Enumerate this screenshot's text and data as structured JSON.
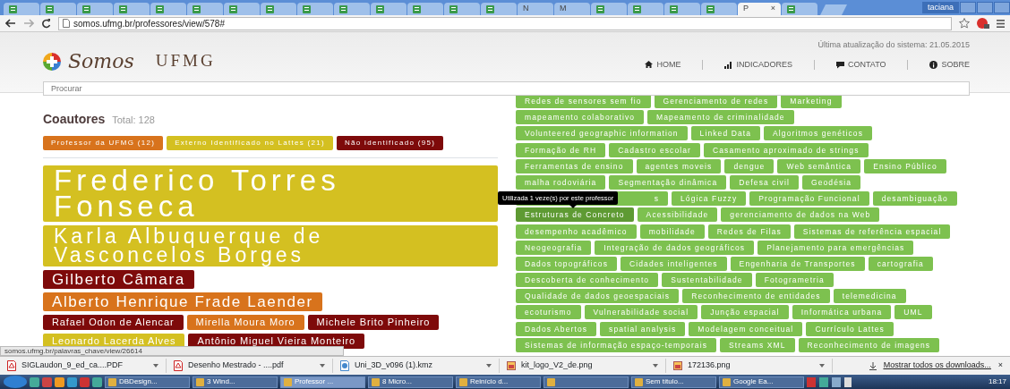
{
  "browser": {
    "tabs": [
      {
        "selected": false
      },
      {
        "selected": false
      },
      {
        "selected": false
      },
      {
        "selected": false
      },
      {
        "selected": false
      },
      {
        "selected": false
      },
      {
        "selected": false
      },
      {
        "selected": false
      },
      {
        "selected": false
      },
      {
        "selected": false
      },
      {
        "selected": false
      },
      {
        "selected": false
      },
      {
        "selected": false
      },
      {
        "selected": false
      },
      {
        "selected": false,
        "label": "N"
      },
      {
        "selected": false,
        "label": "M"
      },
      {
        "selected": false
      },
      {
        "selected": false
      },
      {
        "selected": false
      },
      {
        "selected": false
      },
      {
        "selected": true,
        "label": "P",
        "close": "×"
      },
      {
        "selected": false
      }
    ],
    "user": "taciana",
    "url": "somos.ufmg.br/professores/view/578#"
  },
  "header": {
    "logo_text": "Somos",
    "logo_ufmg": "UFMG",
    "update": "Última atualização do sistema: 21.05.2015",
    "nav": [
      {
        "label": "HOME",
        "kind": "home"
      },
      {
        "label": "INDICADORES",
        "kind": "chart"
      },
      {
        "label": "CONTATO",
        "kind": "comment"
      },
      {
        "label": "SOBRE",
        "kind": "info"
      }
    ],
    "search": {
      "placeholder": "Procurar"
    }
  },
  "coauthors": {
    "title": "Coautores",
    "total": "Total: 128",
    "legend": [
      {
        "label": "Professor da UFMG (12)",
        "color": "#d8731c"
      },
      {
        "label": "Externo Identificado no Lattes (21)",
        "color": "#d4c021"
      },
      {
        "label": "Não identificado (95)",
        "color": "#7e0a0a"
      }
    ],
    "rows": [
      [
        {
          "name": "Frederico Torres Fonseca",
          "color": "#d4c021",
          "kind": "xl"
        }
      ],
      [
        {
          "name": "Karla Albuquerque de Vasconcelos Borges",
          "color": "#d4c021",
          "kind": "lg"
        }
      ],
      [
        {
          "name": "Gilberto Câmara",
          "color": "#7e0a0a",
          "kind": "md"
        }
      ],
      [
        {
          "name": "Alberto Henrique Frade Laender",
          "color": "#d8731c",
          "kind": "md"
        }
      ],
      [
        {
          "name": "Rafael Odon de Alencar",
          "color": "#7e0a0a",
          "kind": "sm"
        },
        {
          "name": "Mirella Moura Moro",
          "color": "#d8731c",
          "kind": "sm"
        },
        {
          "name": "Michele Brito Pinheiro",
          "color": "#7e0a0a",
          "kind": "sm"
        }
      ],
      [
        {
          "name": "Leonardo Lacerda Alves",
          "color": "#d4c021",
          "kind": "sm"
        },
        {
          "name": "Antônio Miguel Vieira Monteiro",
          "color": "#7e0a0a",
          "kind": "sm"
        }
      ]
    ]
  },
  "keywords": {
    "rows": [
      [
        {
          "label": "Redes de sensores sem fio"
        },
        {
          "label": "Gerenciamento de redes"
        },
        {
          "label": "Marketing"
        }
      ],
      [
        {
          "label": "mapeamento colaborativo"
        },
        {
          "label": "Mapeamento de criminalidade"
        }
      ],
      [
        {
          "label": "Volunteered geographic information"
        },
        {
          "label": "Linked Data"
        },
        {
          "label": "Algoritmos genéticos"
        }
      ],
      [
        {
          "label": "Formação de RH"
        },
        {
          "label": "Cadastro escolar"
        },
        {
          "label": "Casamento aproximado de strings"
        }
      ],
      [
        {
          "label": "Ferramentas de ensino"
        },
        {
          "label": "agentes moveis"
        },
        {
          "label": "dengue"
        },
        {
          "label": "Web semântica"
        },
        {
          "label": "Ensino Público"
        }
      ],
      [
        {
          "label": "malha rodoviária"
        },
        {
          "label": "Segmentação dinâmica"
        },
        {
          "label": "Defesa civil"
        },
        {
          "label": "Geodésia"
        }
      ],
      [
        {
          "label": "s",
          "covered": true
        },
        {
          "label": "Lógica Fuzzy"
        },
        {
          "label": "Programação Funcional"
        },
        {
          "label": "desambiguação"
        }
      ],
      [
        {
          "label": "Estruturas de Concreto",
          "hovered": true,
          "tooltip": "Utilizada 1 veze(s) por este professor"
        },
        {
          "label": "Acessibilidade"
        },
        {
          "label": "gerenciamento de dados na Web"
        }
      ],
      [
        {
          "label": "desempenho acadêmico"
        },
        {
          "label": "mobilidade"
        },
        {
          "label": "Redes de Filas"
        },
        {
          "label": "Sistemas de referência espacial"
        }
      ],
      [
        {
          "label": "Neogeografia"
        },
        {
          "label": "Integração de dados geográficos"
        },
        {
          "label": "Planejamento para emergências"
        }
      ],
      [
        {
          "label": "Dados topográficos"
        },
        {
          "label": "Cidades inteligentes"
        },
        {
          "label": "Engenharia de Transportes"
        },
        {
          "label": "cartografia"
        }
      ],
      [
        {
          "label": "Descoberta de conhecimento"
        },
        {
          "label": "Sustentabilidade"
        },
        {
          "label": "Fotogrametria"
        }
      ],
      [
        {
          "label": "Qualidade de dados geoespaciais"
        },
        {
          "label": "Reconhecimento de entidades"
        },
        {
          "label": "telemedicina"
        }
      ],
      [
        {
          "label": "ecoturismo"
        },
        {
          "label": "Vulnerabilidade social"
        },
        {
          "label": "Junção espacial"
        },
        {
          "label": "Informática urbana"
        },
        {
          "label": "UML"
        }
      ],
      [
        {
          "label": "Dados Abertos"
        },
        {
          "label": "spatial analysis"
        },
        {
          "label": "Modelagem conceitual"
        },
        {
          "label": "Currículo Lattes"
        }
      ],
      [
        {
          "label": "Sistemas de informação espaço-temporais"
        },
        {
          "label": "Streams XML"
        },
        {
          "label": "Reconhecimento de imagens"
        }
      ]
    ]
  },
  "status_url": "somos.ufmg.br/palavras_chave/view/26614",
  "downloads": {
    "items": [
      {
        "name": "SIGLaudon_9_ed_ca....PDF",
        "kind": "pdf"
      },
      {
        "name": "Desenho Mestrado - ....pdf",
        "kind": "pdf"
      },
      {
        "name": "Uni_3D_v096 (1).kmz",
        "kind": "kmz"
      },
      {
        "name": "kit_logo_V2_de.png",
        "kind": "png"
      },
      {
        "name": "172136.png",
        "kind": "png"
      }
    ],
    "show_all": "Mostrar todos os downloads...",
    "close": "×"
  },
  "taskbar": {
    "items": [
      {
        "label": "DBDesign...",
        "selected": false
      },
      {
        "label": "3 Wind...",
        "selected": false
      },
      {
        "label": "Professor ...",
        "selected": true
      },
      {
        "label": "8 Micro...",
        "selected": false
      },
      {
        "label": "Reinício d...",
        "selected": false
      },
      {
        "selected": false
      },
      {
        "label": "Sem título...",
        "selected": false
      },
      {
        "label": "Google Ea...",
        "selected": false
      }
    ],
    "clock": "18:17"
  }
}
